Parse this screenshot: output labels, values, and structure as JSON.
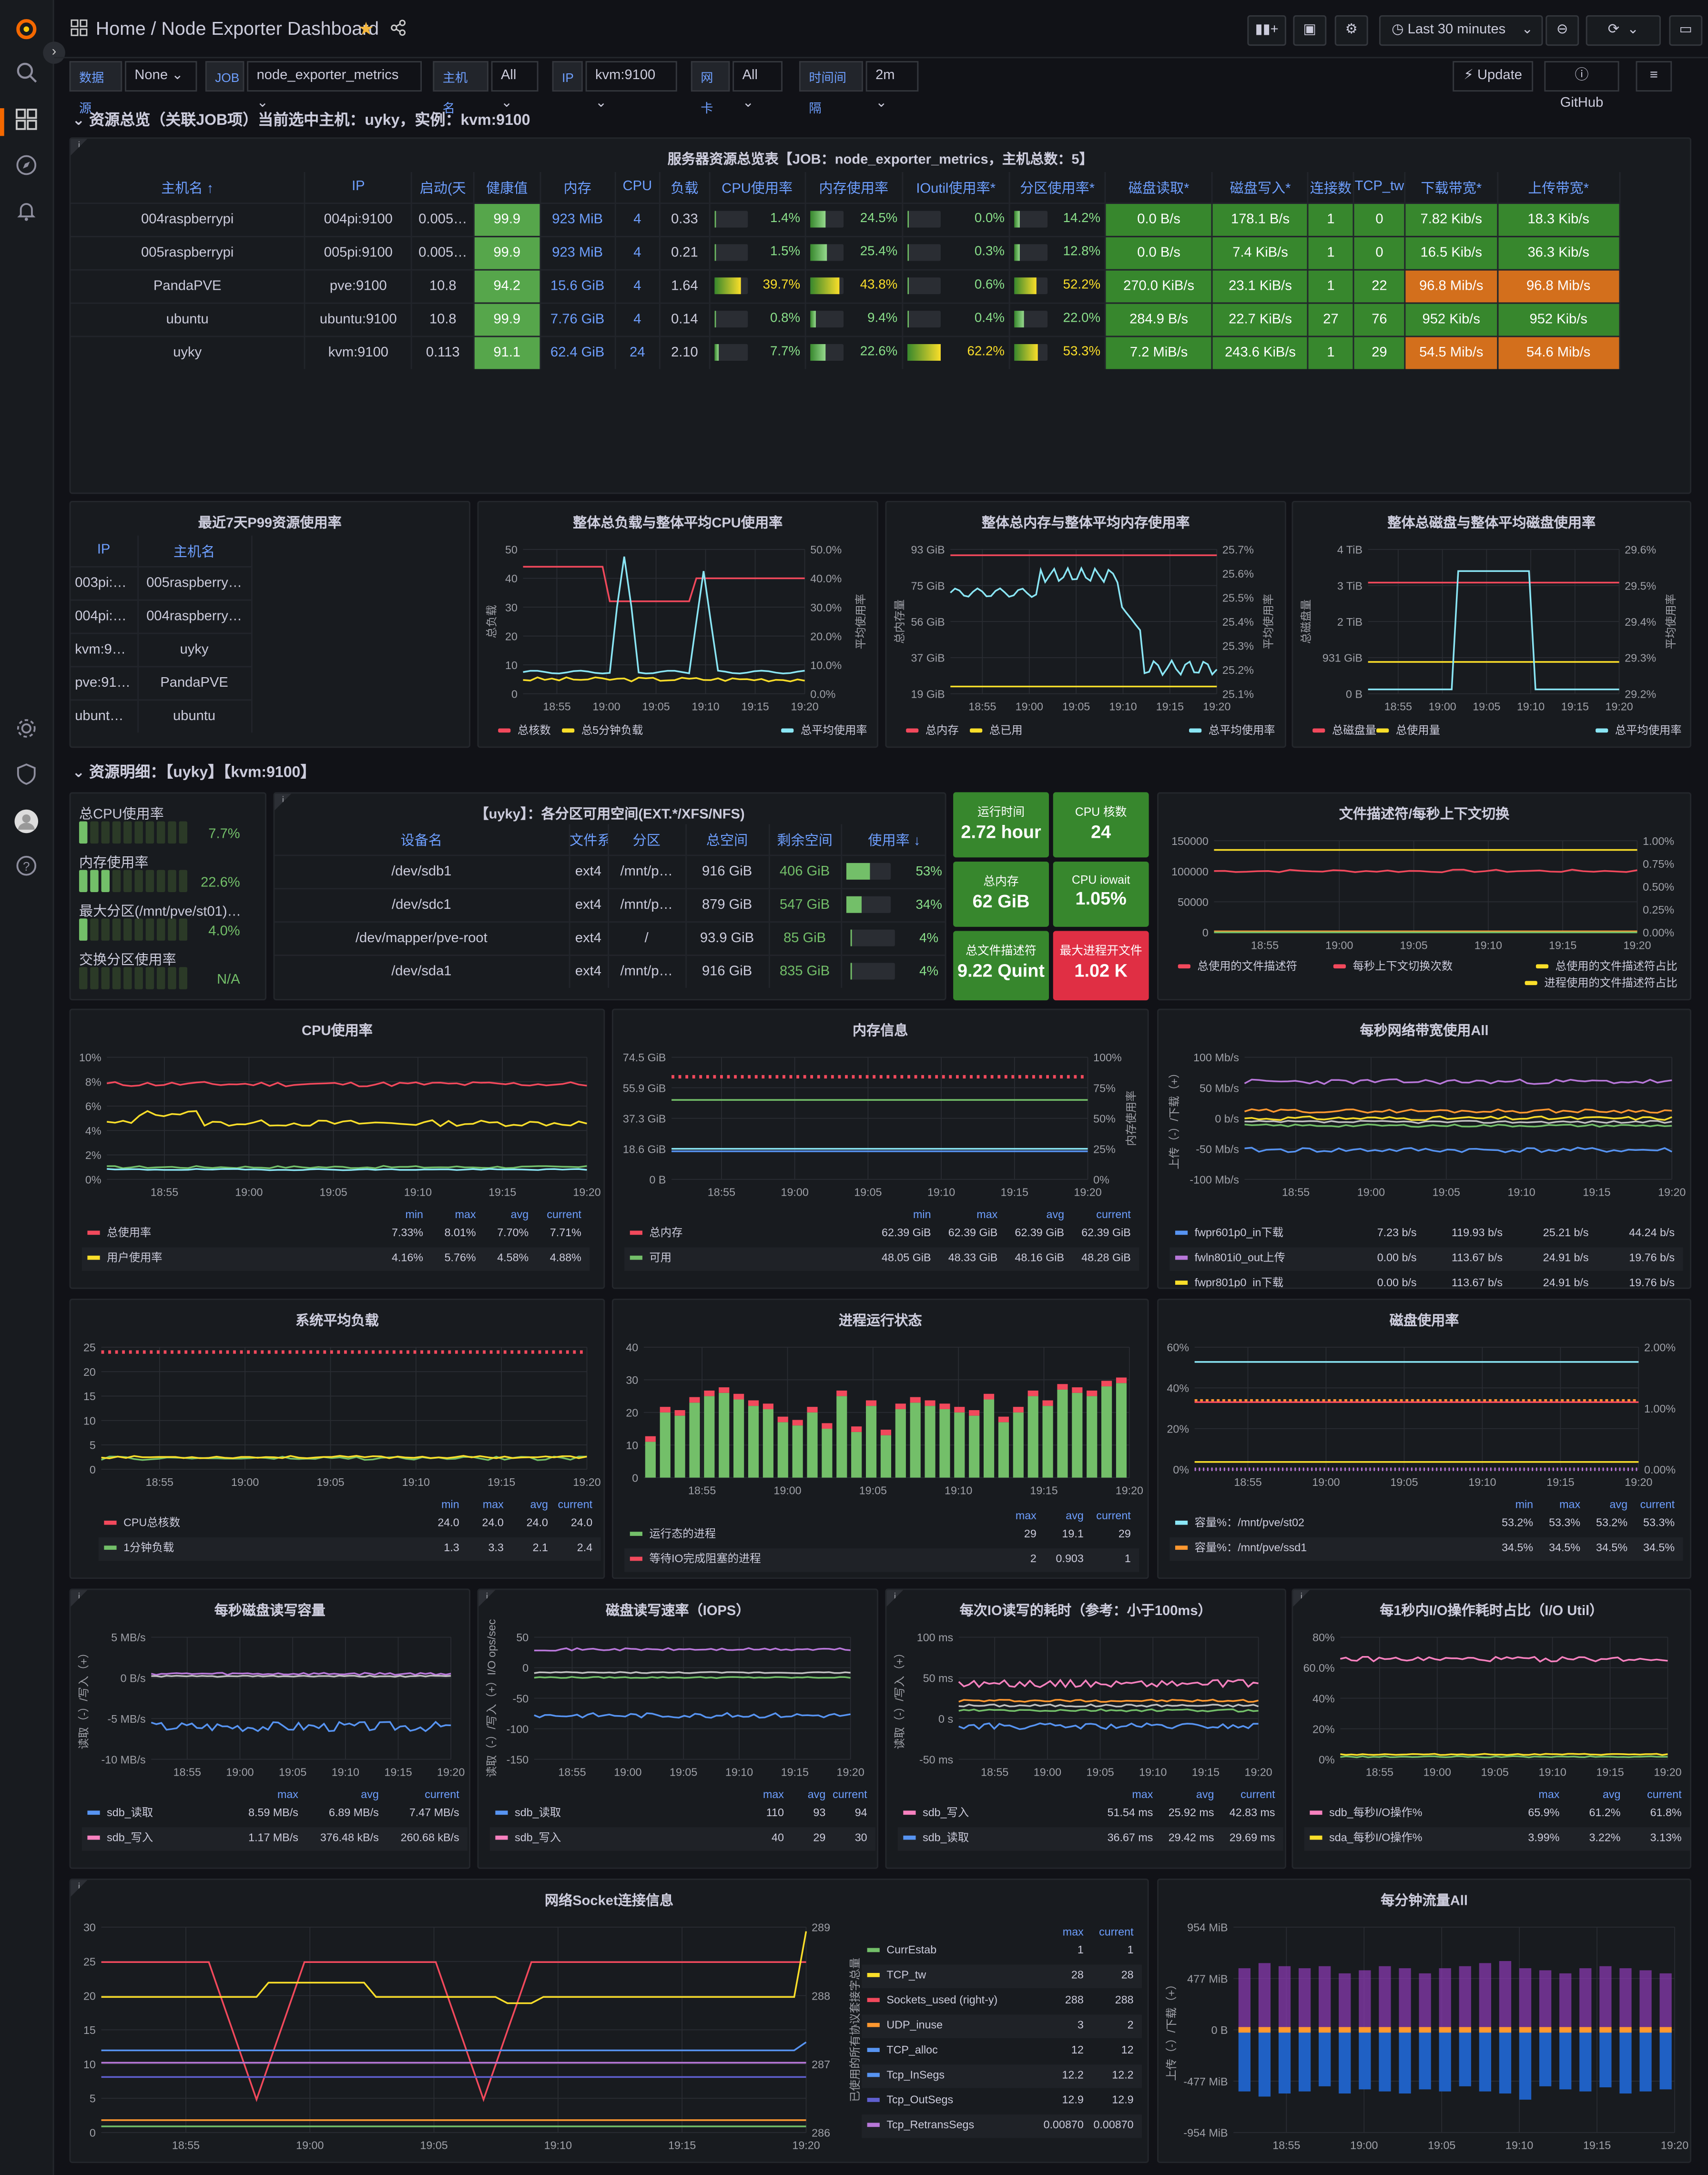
{
  "header": {
    "breadcrumb": "Home / Node Exporter Dashboard",
    "time_range": "Last 30 minutes",
    "update": "Update",
    "github": "GitHub"
  },
  "vars": [
    {
      "label": "数据源",
      "value": "None"
    },
    {
      "label": "JOB",
      "value": "node_exporter_metrics"
    },
    {
      "label": "主机名",
      "value": "All"
    },
    {
      "label": "IP",
      "value": "kvm:9100"
    },
    {
      "label": "网卡",
      "value": "All"
    },
    {
      "label": "时间间隔",
      "value": "2m"
    }
  ],
  "row1": "资源总览（关联JOB项）当前选中主机：uyky，实例：kvm:9100",
  "row2": "资源明细：【uyky】【kvm:9100】",
  "overview": {
    "title": "服务器资源总览表【JOB：node_exporter_metrics，主机总数：5】",
    "headers": [
      "主机名 ↑",
      "IP",
      "启动(天",
      "健康值",
      "内存",
      "CPU",
      "负载",
      "CPU使用率",
      "内存使用率",
      "IOutil使用率*",
      "分区使用率*",
      "磁盘读取*",
      "磁盘写入*",
      "连接数",
      "TCP_tw",
      "下载带宽*",
      "上传带宽*"
    ],
    "rows": [
      [
        "004raspberrypi",
        "004pi:9100",
        "0.005…",
        "99.9",
        "923 MiB",
        "4",
        "0.33",
        "1.4%",
        "24.5%",
        "0.0%",
        "14.2%",
        "0.0 B/s",
        "178.1 B/s",
        "1",
        "0",
        "7.82 Kib/s",
        "18.3 Kib/s"
      ],
      [
        "005raspberrypi",
        "005pi:9100",
        "0.005…",
        "99.9",
        "923 MiB",
        "4",
        "0.21",
        "1.5%",
        "25.4%",
        "0.3%",
        "12.8%",
        "0.0 B/s",
        "7.4 KiB/s",
        "1",
        "0",
        "16.5 Kib/s",
        "36.3 Kib/s"
      ],
      [
        "PandaPVE",
        "pve:9100",
        "10.8",
        "94.2",
        "15.6 GiB",
        "4",
        "1.64",
        "39.7%",
        "43.8%",
        "0.6%",
        "52.2%",
        "270.0 KiB/s",
        "23.1 KiB/s",
        "1",
        "22",
        "96.8 Mib/s",
        "96.8 Mib/s"
      ],
      [
        "ubuntu",
        "ubuntu:9100",
        "10.8",
        "99.9",
        "7.76 GiB",
        "4",
        "0.14",
        "0.8%",
        "9.4%",
        "0.4%",
        "22.0%",
        "284.9 B/s",
        "22.7 KiB/s",
        "27",
        "76",
        "952 Kib/s",
        "952 Kib/s"
      ],
      [
        "uyky",
        "kvm:9100",
        "0.113",
        "91.1",
        "62.4 GiB",
        "24",
        "2.10",
        "7.7%",
        "22.6%",
        "62.2%",
        "53.3%",
        "7.2 MiB/s",
        "243.6 KiB/s",
        "1",
        "29",
        "54.5 Mib/s",
        "54.6 Mib/s"
      ]
    ],
    "bar_fracs": [
      [
        0.014,
        0.245,
        0.0,
        0.142
      ],
      [
        0.015,
        0.254,
        0.003,
        0.128
      ],
      [
        0.397,
        0.438,
        0.006,
        0.522
      ],
      [
        0.008,
        0.094,
        0.004,
        0.22
      ],
      [
        0.077,
        0.226,
        0.622,
        0.533
      ]
    ]
  },
  "p99": {
    "title": "最近7天P99资源使用率",
    "headers": [
      "IP",
      "主机名"
    ],
    "rows": [
      [
        "003pi:…",
        "005raspberry…"
      ],
      [
        "004pi:…",
        "004raspberry…"
      ],
      [
        "kvm:9…",
        "uyky"
      ],
      [
        "pve:91…",
        "PandaPVE"
      ],
      [
        "ubunt…",
        "ubuntu"
      ]
    ]
  },
  "loadchart": {
    "title": "整体总负载与整体平均CPU使用率",
    "yl": [
      "50",
      "40",
      "30",
      "20",
      "10",
      "0"
    ],
    "yr": [
      "50.0%",
      "40.0%",
      "30.0%",
      "20.0%",
      "10.0%",
      "0.0%"
    ],
    "ylabel": "总负载",
    "yrlabel": "平均使用率",
    "legend": [
      "总核数",
      "总5分钟负载",
      "总平均使用率"
    ]
  },
  "memchart": {
    "title": "整体总内存与整体平均内存使用率",
    "yl": [
      "93 GiB",
      "75 GiB",
      "56 GiB",
      "37 GiB",
      "19 GiB"
    ],
    "yr": [
      "25.7%",
      "25.6%",
      "25.5%",
      "25.4%",
      "25.3%",
      "25.2%",
      "25.1%"
    ],
    "ylabel": "总内存量",
    "yrlabel": "平均使用率",
    "legend": [
      "总内存",
      "总已用",
      "总平均使用率"
    ]
  },
  "diskchart": {
    "title": "整体总磁盘与整体平均磁盘使用率",
    "yl": [
      "4 TiB",
      "3 TiB",
      "2 TiB",
      "931 GiB",
      "0 B"
    ],
    "yr": [
      "29.6%",
      "29.5%",
      "29.4%",
      "29.3%",
      "29.2%"
    ],
    "ylabel": "总磁盘量",
    "yrlabel": "平均使用率",
    "legend": [
      "总磁盘量",
      "总使用量",
      "总平均使用率"
    ]
  },
  "xt6": [
    "18:55",
    "19:00",
    "19:05",
    "19:10",
    "19:15",
    "19:20"
  ],
  "gauges": [
    {
      "label": "总CPU使用率",
      "value": "7.7%",
      "cells": 1
    },
    {
      "label": "内存使用率",
      "value": "22.6%",
      "cells": 3
    },
    {
      "label": "最大分区(/mnt/pve/st01)…",
      "value": "4.0%",
      "cells": 1
    },
    {
      "label": "交换分区使用率",
      "value": "N/A",
      "cells": 0
    }
  ],
  "fs": {
    "title": "【uyky】：各分区可用空间(EXT.*/XFS/NFS)",
    "headers": [
      "设备名",
      "文件系",
      "分区",
      "总空间",
      "剩余空间",
      "使用率 ↓"
    ],
    "rows": [
      [
        "/dev/sdb1",
        "ext4",
        "/mnt/p…",
        "916 GiB",
        "406 GiB",
        "53%"
      ],
      [
        "/dev/sdc1",
        "ext4",
        "/mnt/p…",
        "879 GiB",
        "547 GiB",
        "34%"
      ],
      [
        "/dev/mapper/pve-root",
        "ext4",
        "/",
        "93.9 GiB",
        "85 GiB",
        "4%"
      ],
      [
        "/dev/sda1",
        "ext4",
        "/mnt/p…",
        "916 GiB",
        "835 GiB",
        "4%"
      ]
    ],
    "fracs": [
      0.53,
      0.34,
      0.04,
      0.04
    ]
  },
  "stats": [
    {
      "t": "运行时间",
      "v": "2.72 hour"
    },
    {
      "t": "CPU 核数",
      "v": "24"
    },
    {
      "t": "总内存",
      "v": "62 GiB"
    },
    {
      "t": "CPU iowait",
      "v": "1.05%"
    },
    {
      "t": "总文件描述符",
      "v": "9.22 Quint"
    },
    {
      "t": "最大进程开文件",
      "v": "1.02 K"
    }
  ],
  "fdchart": {
    "title": "文件描述符/每秒上下文切换",
    "yl": [
      "150000",
      "100000",
      "50000",
      "0"
    ],
    "yr": [
      "1.00%",
      "0.75%",
      "0.50%",
      "0.25%",
      "0.00%"
    ],
    "legend": [
      "总使用的文件描述符",
      "每秒上下文切换次数",
      "总使用的文件描述符占比",
      "进程使用的文件描述符占比"
    ]
  },
  "cpu": {
    "title": "CPU使用率",
    "yl": [
      "10%",
      "8%",
      "6%",
      "4%",
      "2%",
      "0%"
    ],
    "cols": [
      "min",
      "max",
      "avg",
      "current"
    ],
    "rows": [
      [
        "总使用率",
        "7.33%",
        "8.01%",
        "7.70%",
        "7.71%"
      ],
      [
        "用户使用率",
        "4.16%",
        "5.76%",
        "4.58%",
        "4.88%"
      ]
    ]
  },
  "mem": {
    "title": "内存信息",
    "yl": [
      "74.5 GiB",
      "55.9 GiB",
      "37.3 GiB",
      "18.6 GiB",
      "0 B"
    ],
    "yr": [
      "100%",
      "75%",
      "50%",
      "25%",
      "0%"
    ],
    "yrlabel": "内存使用率",
    "cols": [
      "min",
      "max",
      "avg",
      "current"
    ],
    "rows": [
      [
        "总内存",
        "62.39 GiB",
        "62.39 GiB",
        "62.39 GiB",
        "62.39 GiB"
      ],
      [
        "可用",
        "48.05 GiB",
        "48.33 GiB",
        "48.16 GiB",
        "48.28 GiB"
      ]
    ]
  },
  "net": {
    "title": "每秒网络带宽使用All",
    "yl": [
      "100 Mb/s",
      "50 Mb/s",
      "0 b/s",
      "-50 Mb/s",
      "-100 Mb/s"
    ],
    "ylabel": "上传（-）/下载（+）",
    "rows": [
      [
        "fwpr601p0_in下载",
        "7.23 b/s",
        "119.93 b/s",
        "25.21 b/s",
        "44.24 b/s"
      ],
      [
        "fwln801i0_out上传",
        "0.00 b/s",
        "113.67 b/s",
        "24.91 b/s",
        "19.76 b/s"
      ],
      [
        "fwpr801p0_in下载",
        "0.00 b/s",
        "113.67 b/s",
        "24.91 b/s",
        "19.76 b/s"
      ]
    ]
  },
  "sysload": {
    "title": "系统平均负载",
    "yl": [
      "25",
      "20",
      "15",
      "10",
      "5",
      "0"
    ],
    "cols": [
      "min",
      "max",
      "avg",
      "current"
    ],
    "rows": [
      [
        "CPU总核数",
        "24.0",
        "24.0",
        "24.0",
        "24.0"
      ],
      [
        "1分钟负载",
        "1.3",
        "3.3",
        "2.1",
        "2.4"
      ]
    ]
  },
  "procs": {
    "title": "进程运行状态",
    "yl": [
      "40",
      "30",
      "20",
      "10",
      "0"
    ],
    "cols": [
      "max",
      "avg",
      "current"
    ],
    "rows": [
      [
        "运行态的进程",
        "29",
        "19.1",
        "29"
      ],
      [
        "等待IO完成阻塞的进程",
        "2",
        "0.903",
        "1"
      ]
    ],
    "bars": [
      11,
      20,
      19,
      23,
      25,
      26,
      24,
      22,
      21,
      17,
      16,
      20,
      15,
      25,
      14,
      22,
      13,
      21,
      23,
      22,
      21,
      20,
      19,
      24,
      17,
      20,
      25,
      22,
      27,
      26,
      25,
      28,
      29
    ]
  },
  "diskuse": {
    "title": "磁盘使用率",
    "yl": [
      "60%",
      "40%",
      "20%",
      "0%"
    ],
    "yr": [
      "2.00%",
      "1.00%",
      "0.00%"
    ],
    "cols": [
      "min",
      "max",
      "avg",
      "current"
    ],
    "rows": [
      [
        "容量%：/mnt/pve/st02",
        "53.2%",
        "53.3%",
        "53.2%",
        "53.3%"
      ],
      [
        "容量%：/mnt/pve/ssd1",
        "34.5%",
        "34.5%",
        "34.5%",
        "34.5%"
      ]
    ]
  },
  "diskrw": {
    "title": "每秒磁盘读写容量",
    "yl": [
      "5 MB/s",
      "0 B/s",
      "-5 MB/s",
      "-10 MB/s"
    ],
    "ylabel": "读取（-）/写入（+）",
    "cols": [
      "max",
      "avg",
      "current"
    ],
    "rows": [
      [
        "sdb_读取",
        "8.59 MB/s",
        "6.89 MB/s",
        "7.47 MB/s"
      ],
      [
        "sdb_写入",
        "1.17 MB/s",
        "376.48 kB/s",
        "260.68 kB/s"
      ]
    ]
  },
  "iops": {
    "title": "磁盘读写速率（IOPS）",
    "yl": [
      "50",
      "0",
      "-50",
      "-100",
      "-150"
    ],
    "ylabel": "读取（-）/写入（+）I/O ops/sec",
    "cols": [
      "max",
      "avg",
      "current"
    ],
    "rows": [
      [
        "sdb_读取",
        "110",
        "93",
        "94"
      ],
      [
        "sdb_写入",
        "40",
        "29",
        "30"
      ]
    ]
  },
  "iolat": {
    "title": "每次IO读写的耗时（参考：小于100ms）",
    "yl": [
      "100 ms",
      "50 ms",
      "0 s",
      "-50 ms"
    ],
    "ylabel": "读取（-）/写入（+）",
    "cols": [
      "max",
      "avg",
      "current"
    ],
    "rows": [
      [
        "sdb_写入",
        "51.54 ms",
        "25.92 ms",
        "42.83 ms"
      ],
      [
        "sdb_读取",
        "36.67 ms",
        "29.42 ms",
        "29.69 ms"
      ]
    ]
  },
  "ioutil": {
    "title": "每1秒内I/O操作耗时占比（I/O Util）",
    "yl": [
      "80%",
      "60.0%",
      "40%",
      "20%",
      "0%"
    ],
    "cols": [
      "max",
      "avg",
      "current"
    ],
    "rows": [
      [
        "sdb_每秒I/O操作%",
        "65.9%",
        "61.2%",
        "61.8%"
      ],
      [
        "sda_每秒I/O操作%",
        "3.99%",
        "3.22%",
        "3.13%"
      ]
    ]
  },
  "sock": {
    "title": "网络Socket连接信息",
    "yl": [
      "30",
      "25",
      "20",
      "15",
      "10",
      "5",
      "0"
    ],
    "yr": [
      "289",
      "288",
      "287",
      "286"
    ],
    "yrlabel": "已使用的所有协议套接字总量",
    "cols": [
      "max",
      "current"
    ],
    "rows": [
      [
        "CurrEstab",
        "1",
        "1"
      ],
      [
        "TCP_tw",
        "28",
        "28"
      ],
      [
        "Sockets_used (right-y)",
        "288",
        "288"
      ],
      [
        "UDP_inuse",
        "3",
        "2"
      ],
      [
        "TCP_alloc",
        "12",
        "12"
      ],
      [
        "Tcp_InSegs",
        "12.2",
        "12.2"
      ],
      [
        "Tcp_OutSegs",
        "12.9",
        "12.9"
      ],
      [
        "Tcp_RetransSegs",
        "0.00870",
        "0.00870"
      ]
    ]
  },
  "traffic": {
    "title": "每分钟流量All",
    "yl": [
      "954 MiB",
      "477 MiB",
      "0 B",
      "-477 MiB",
      "-954 MiB"
    ],
    "ylabel": "上传（-）/下载（+）"
  },
  "colors": {
    "green": "#73bf69",
    "red": "#f2495c",
    "yellow": "#fade2a",
    "blue": "#5794f2",
    "cyan": "#8ae6f5",
    "orange": "#ff9830",
    "purple": "#b877d9"
  }
}
